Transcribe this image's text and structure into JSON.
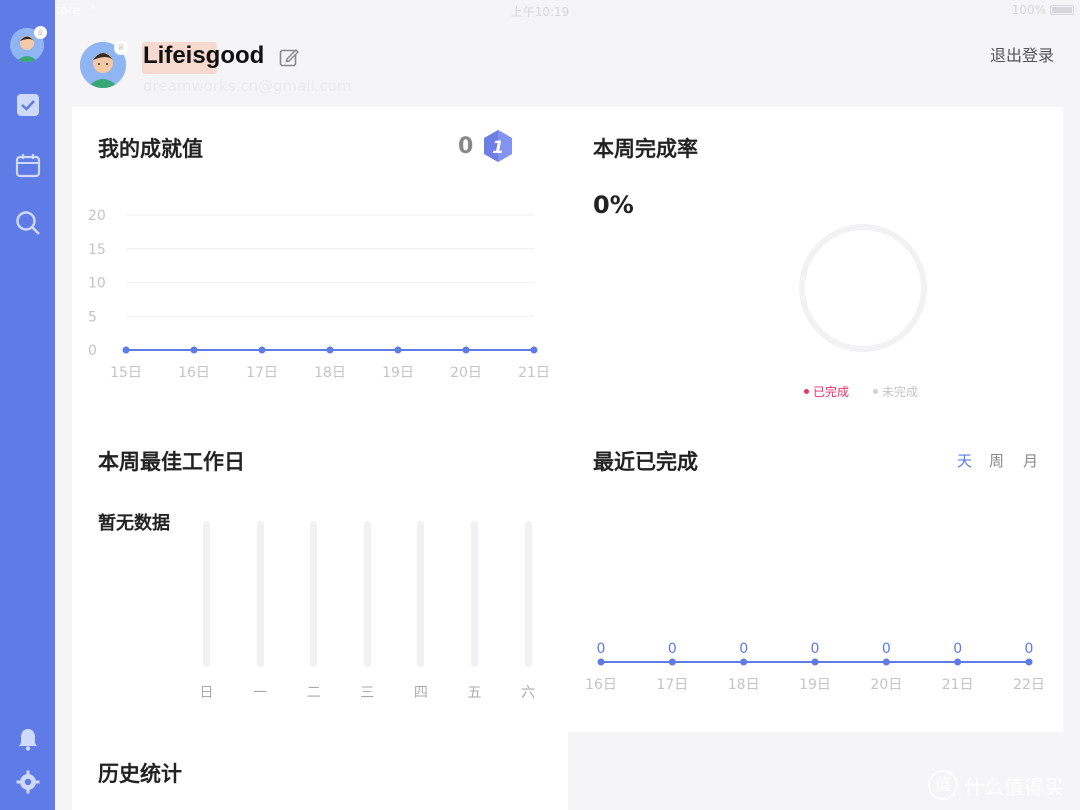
{
  "status_bar": {
    "back_label": "App Store",
    "time": "上午10:19",
    "battery": "100%"
  },
  "sidebar": {
    "items": [
      {
        "icon": "checkbox-icon",
        "name": "tasks"
      },
      {
        "icon": "calendar-icon",
        "name": "calendar"
      },
      {
        "icon": "search-icon",
        "name": "search"
      },
      {
        "icon": "bell-icon",
        "name": "notifications"
      },
      {
        "icon": "gear-icon",
        "name": "settings"
      }
    ],
    "color": "#5e7be6"
  },
  "profile": {
    "username": "Lifeisgood",
    "email": "dreamworks.cn@gmail.com",
    "logout_label": "退出登录"
  },
  "achievement": {
    "title": "我的成就值",
    "score": "0",
    "level": "1"
  },
  "completion": {
    "title": "本周完成率",
    "percent": "0%",
    "legend": [
      {
        "label": "已完成",
        "color": "#e8336b"
      },
      {
        "label": "未完成",
        "color": "#d0d0d4"
      }
    ]
  },
  "best_day": {
    "title": "本周最佳工作日",
    "empty_text": "暂无数据",
    "days": [
      "日",
      "一",
      "二",
      "三",
      "四",
      "五",
      "六"
    ]
  },
  "recent": {
    "title": "最近已完成",
    "tabs": [
      "天",
      "周",
      "月"
    ],
    "active_tab": 0
  },
  "history": {
    "title": "历史统计"
  },
  "watermark": {
    "text": "什么值得买",
    "icon": "值"
  },
  "chart_data": [
    {
      "type": "line",
      "title": "我的成就值",
      "categories": [
        "15日",
        "16日",
        "17日",
        "18日",
        "19日",
        "20日",
        "21日"
      ],
      "series": [
        {
          "values": [
            0,
            0,
            0,
            0,
            0,
            0,
            0
          ]
        }
      ],
      "ylim": [
        0,
        20
      ],
      "yticks": [
        "20",
        "15",
        "10",
        "5",
        "0"
      ],
      "grid": true,
      "color": "#5e7be6"
    },
    {
      "type": "pie",
      "title": "本周完成率",
      "labels": [
        "已完成",
        "未完成"
      ],
      "values": [
        0,
        100
      ]
    },
    {
      "type": "bar",
      "title": "本周最佳工作日",
      "categories": [
        "日",
        "一",
        "二",
        "三",
        "四",
        "五",
        "六"
      ],
      "values": [
        0,
        0,
        0,
        0,
        0,
        0,
        0
      ]
    },
    {
      "type": "line",
      "title": "最近已完成",
      "categories": [
        "16日",
        "17日",
        "18日",
        "19日",
        "20日",
        "21日",
        "22日"
      ],
      "series": [
        {
          "values": [
            0,
            0,
            0,
            0,
            0,
            0,
            0
          ]
        }
      ],
      "data_labels": [
        "0",
        "0",
        "0",
        "0",
        "0",
        "0",
        "0"
      ],
      "color": "#5e7be6"
    }
  ]
}
